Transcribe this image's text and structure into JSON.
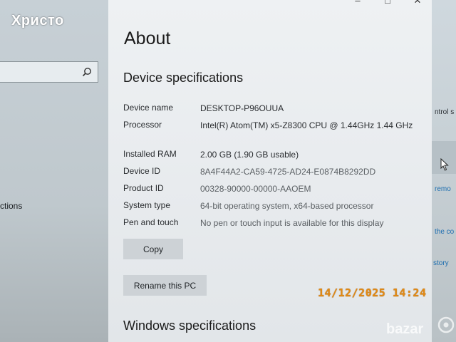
{
  "watermark": "Христо",
  "timestamp": "14/12/2025 14:24",
  "brand_logo": "bazar-logo",
  "left_window": {
    "search_icon": "search-icon",
    "partial_item": "ctions"
  },
  "right_window": {
    "partial_texts": [
      "ntrol s",
      "remo",
      "the co",
      "story"
    ]
  },
  "window_controls": [
    "–",
    "□",
    "✕"
  ],
  "page_title": "About",
  "device_specs": {
    "title": "Device specifications",
    "rows": [
      {
        "label": "Device name",
        "value": "DESKTOP-P96OUUA"
      },
      {
        "label": "Processor",
        "value": "Intel(R) Atom(TM) x5-Z8300  CPU @ 1.44GHz   1.44 GHz"
      },
      {
        "label": "Installed RAM",
        "value": "2.00 GB (1.90 GB usable)"
      },
      {
        "label": "Device ID",
        "value": "8A4F44A2-CA59-4725-AD24-E0874B8292DD"
      },
      {
        "label": "Product ID",
        "value": "00328-90000-00000-AAOEM"
      },
      {
        "label": "System type",
        "value": "64-bit operating system, x64-based processor"
      },
      {
        "label": "Pen and touch",
        "value": "No pen or touch input is available for this display"
      }
    ]
  },
  "buttons": {
    "copy": "Copy",
    "rename": "Rename this PC"
  },
  "windows_specs_title": "Windows specifications"
}
